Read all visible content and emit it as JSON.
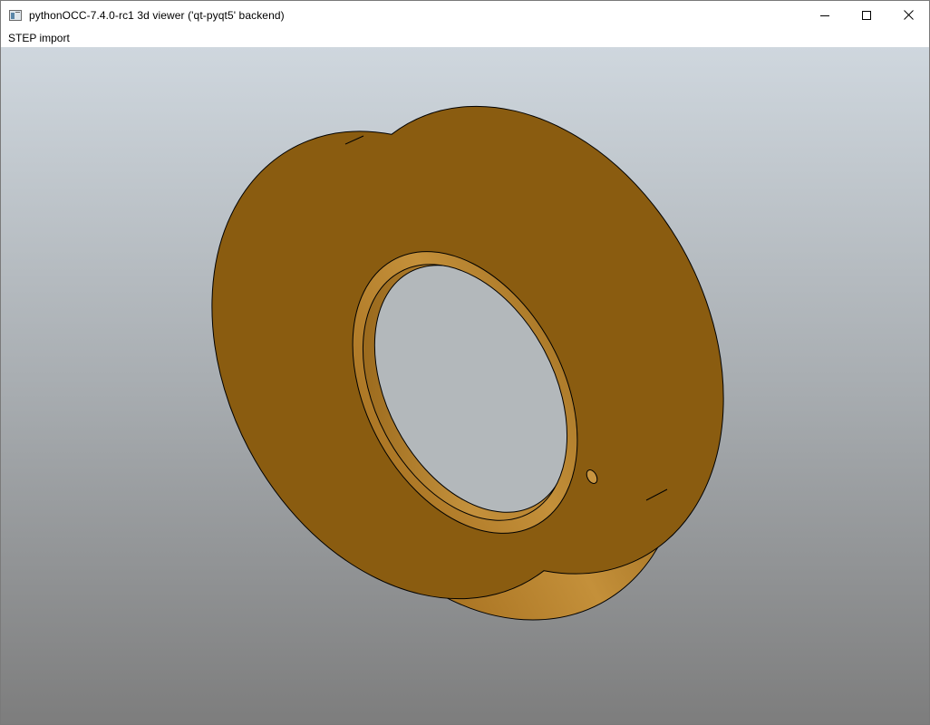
{
  "window": {
    "title": "pythonOCC-7.4.0-rc1 3d viewer ('qt-pyqt5' backend)",
    "controls": [
      "minimize-icon",
      "maximize-icon",
      "close-icon"
    ]
  },
  "menubar": {
    "items": [
      {
        "label": "STEP import"
      }
    ]
  },
  "viewport": {
    "background_top": "#cfd7de",
    "background_bottom": "#7d7d7d",
    "model": {
      "face_color": "#8a5c10",
      "edge_color": "#000000",
      "highlight_color": "#c4903a"
    }
  }
}
